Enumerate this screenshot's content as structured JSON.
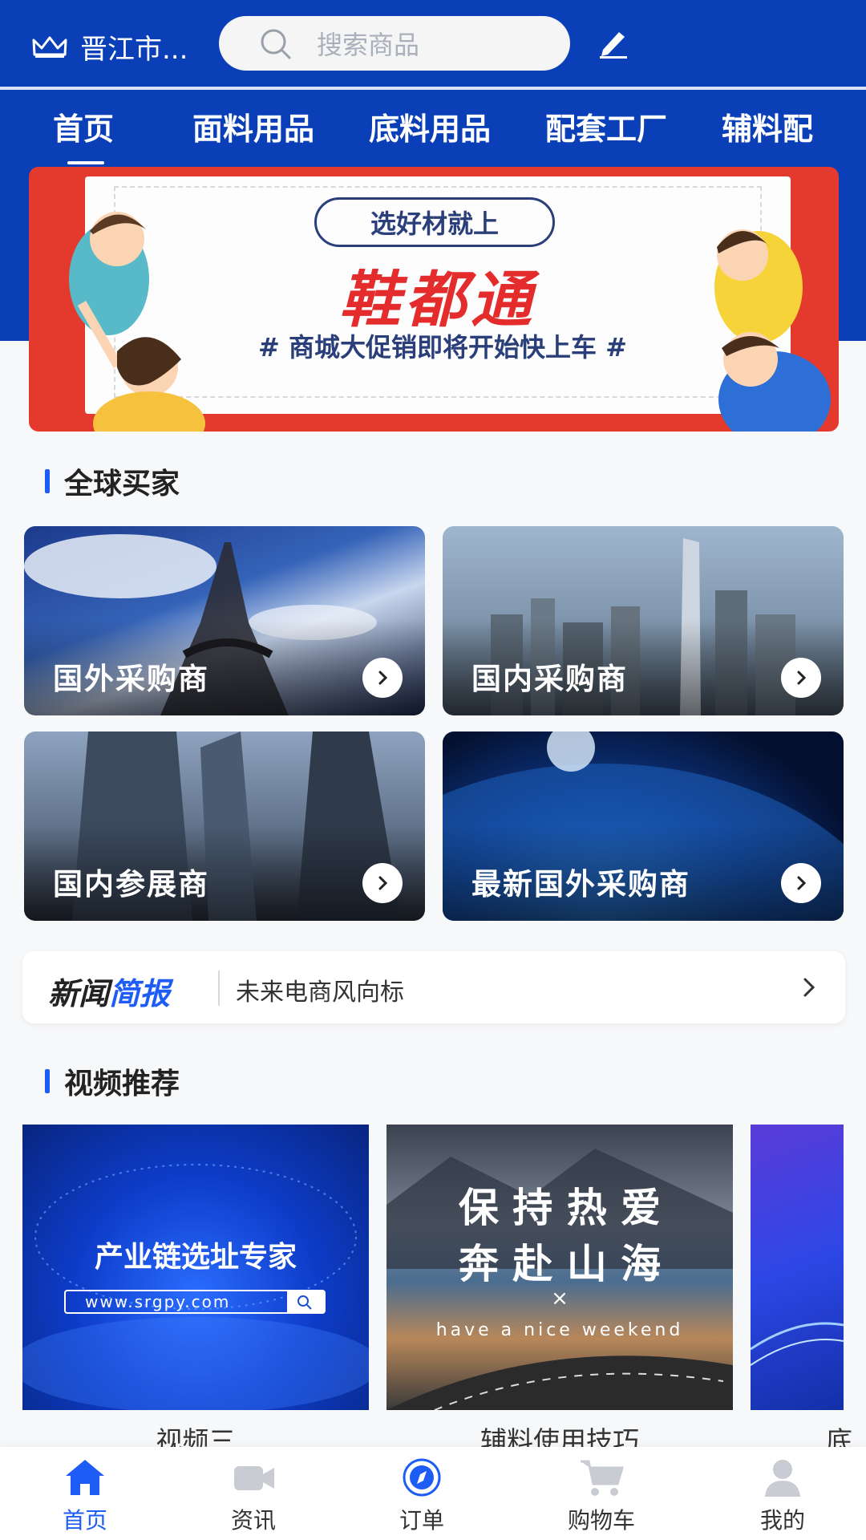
{
  "header": {
    "city": "晋江市...",
    "search_placeholder": "搜索商品"
  },
  "tabs": [
    {
      "label": "首页",
      "active": true
    },
    {
      "label": "面料用品"
    },
    {
      "label": "底料用品"
    },
    {
      "label": "配套工厂"
    },
    {
      "label": "辅料配"
    }
  ],
  "banner": {
    "pill": "选好材就上",
    "brand": "鞋都通",
    "slogan": "# 商城大促销即将开始快上车 #"
  },
  "buyers": {
    "title": "全球买家",
    "cards": [
      {
        "label": "国外采购商",
        "icon": "chevron-right-icon"
      },
      {
        "label": "国内采购商",
        "icon": "chevron-right-icon"
      },
      {
        "label": "国内参展商",
        "icon": "chevron-right-icon"
      },
      {
        "label": "最新国外采购商",
        "icon": "chevron-right-icon"
      }
    ]
  },
  "news": {
    "logo_part1": "新闻",
    "logo_part2": "简报",
    "headline": "未来电商风向标"
  },
  "videos": {
    "title": "视频推荐",
    "items": [
      {
        "caption": "视频三",
        "overlay_title": "产业链选址专家",
        "overlay_url": "www.srgpy.com"
      },
      {
        "caption": "辅料使用技巧",
        "overlay_line1": "保 持 热 爱",
        "overlay_line2": "奔 赴 山 海",
        "overlay_x": "×",
        "overlay_en": "have a nice weekend"
      },
      {
        "caption": "底"
      }
    ]
  },
  "bottom_nav": [
    {
      "label": "首页",
      "icon": "home-icon",
      "active": true
    },
    {
      "label": "资讯",
      "icon": "video-camera-icon"
    },
    {
      "label": "订单",
      "icon": "compass-icon"
    },
    {
      "label": "购物车",
      "icon": "cart-icon"
    },
    {
      "label": "我的",
      "icon": "user-icon"
    }
  ],
  "colors": {
    "primary": "#0a3fb8",
    "accent": "#1e5df5",
    "banner_red": "#e43a2d"
  }
}
